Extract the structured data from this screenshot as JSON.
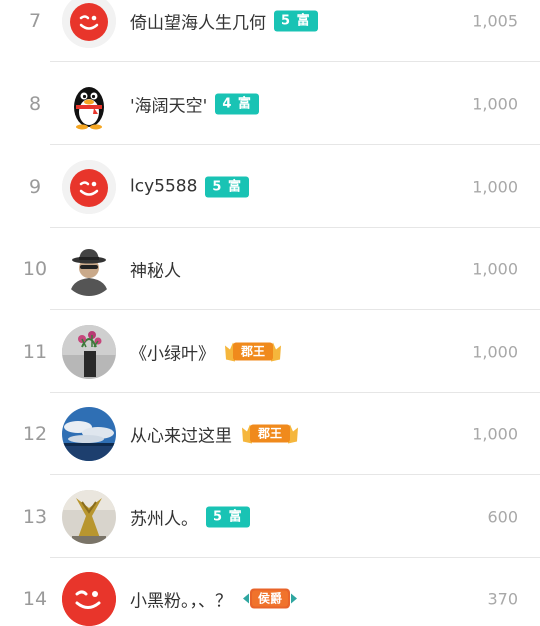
{
  "rows": [
    {
      "rank": "7",
      "avatar": "weibo-red-icon",
      "name": "倚山望海人生几何",
      "badge_type": "fu",
      "badge": "5 富",
      "score": "1,005"
    },
    {
      "rank": "8",
      "avatar": "qq-penguin-icon",
      "name": "'海阔天空'",
      "badge_type": "fu",
      "badge": "4 富",
      "score": "1,000"
    },
    {
      "rank": "9",
      "avatar": "weibo-red-icon",
      "name": "lcy5588",
      "badge_type": "fu",
      "badge": "5 富",
      "score": "1,000"
    },
    {
      "rank": "10",
      "avatar": "mystery-man-icon",
      "name": "神秘人",
      "badge_type": "none",
      "badge": "",
      "score": "1,000"
    },
    {
      "rank": "11",
      "avatar": "vase-photo",
      "name": "《小绿叶》",
      "badge_type": "king",
      "badge": "郡王",
      "score": "1,000"
    },
    {
      "rank": "12",
      "avatar": "sky-photo",
      "name": "从心来过这里",
      "badge_type": "king",
      "badge": "郡王",
      "score": "1,000"
    },
    {
      "rank": "13",
      "avatar": "statue-photo",
      "name": "苏州人。",
      "badge_type": "fu",
      "badge": "5 富",
      "score": "600"
    },
    {
      "rank": "14",
      "avatar": "weibo-red-big-icon",
      "name": "小黑粉。，、？",
      "badge_type": "hou",
      "badge": "侯爵",
      "score": "370"
    }
  ],
  "colors": {
    "fu_badge": "#19c3b4",
    "king_badge": "#f39a1c",
    "weibo_red": "#e8352b"
  }
}
